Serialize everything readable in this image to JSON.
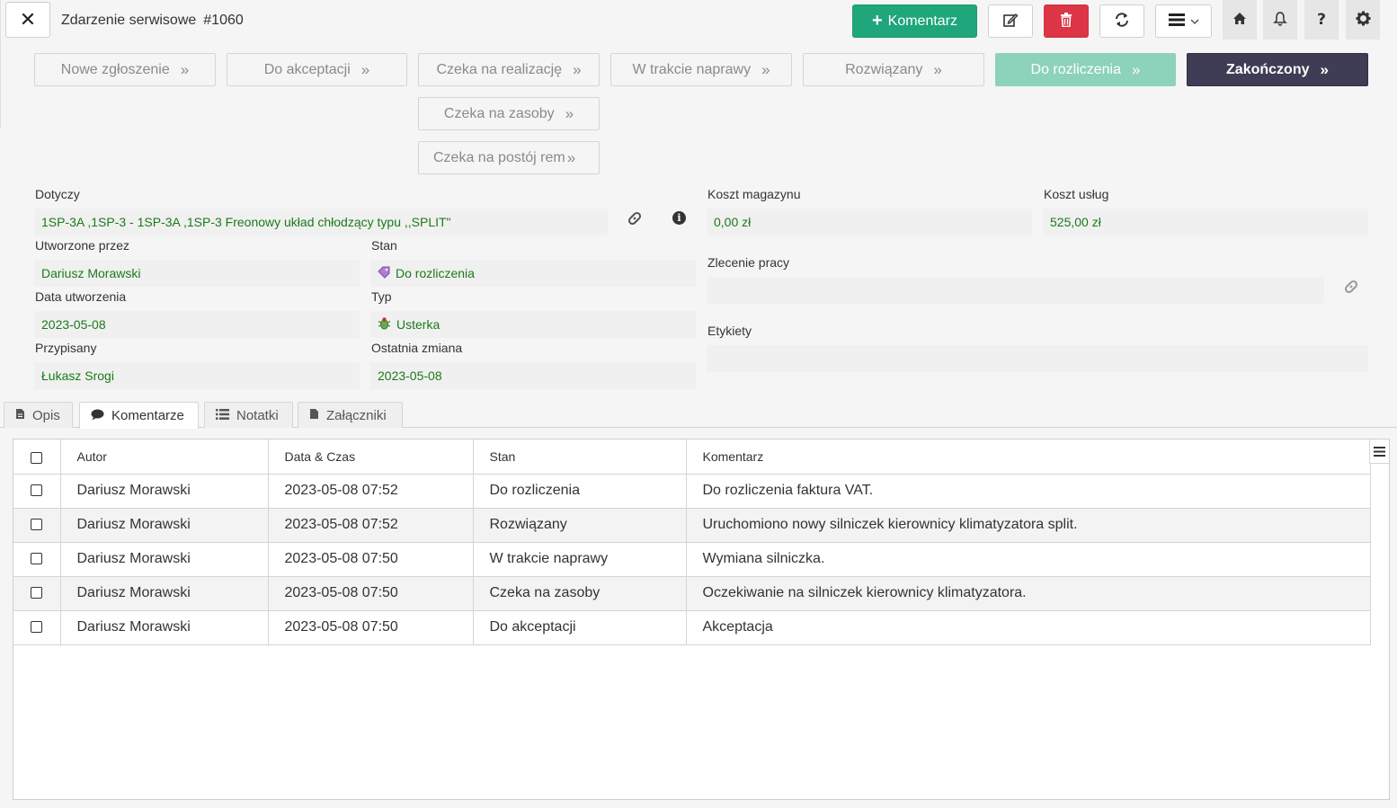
{
  "header": {
    "title": "Zdarzenie serwisowe",
    "record_number": "#1060",
    "close_icon": "✕",
    "comment_button_label": "Komentarz",
    "plus_icon": "+",
    "edit_icon": "✎",
    "delete_icon": "🗑",
    "refresh_icon": "⟳",
    "menu_icon": "☰",
    "menu_chevron": "⌄",
    "home_icon": "⌂",
    "bell_icon": "🔔",
    "help_icon": "?",
    "settings_icon": "⚙",
    "colors": {
      "comment": "#1fa67a",
      "delete": "#dc3545",
      "final_status": "#3f3d56",
      "current_status": "#8dd2bb"
    }
  },
  "workflow": {
    "chevron": "»",
    "statuses": [
      "Nowe zgłoszenie",
      "Do akceptacji",
      "Czeka na realizację",
      "W trakcie naprawy",
      "Rozwiązany",
      "Do rozliczenia",
      "Zakończony",
      "Czeka na zasoby",
      "Czeka na postój rem"
    ]
  },
  "form": {
    "dotyczy": {
      "label": "Dotyczy",
      "value": "1SP-3A ,1SP-3 - 1SP-3A ,1SP-3 Freonowy układ chłodzący typu ,,SPLIT\""
    },
    "link_icon": "🔗",
    "info_icon": "i",
    "koszt_magazynu": {
      "label": "Koszt magazynu",
      "value": "0,00 zł"
    },
    "koszt_uslug": {
      "label": "Koszt usług",
      "value": "525,00 zł"
    },
    "utworzone_przez": {
      "label": "Utworzone przez",
      "value": "Dariusz Morawski"
    },
    "stan": {
      "label": "Stan",
      "value": "Do rozliczenia",
      "icon": "🏷"
    },
    "zlecenie_pracy": {
      "label": "Zlecenie pracy",
      "value": ""
    },
    "data_utworzenia": {
      "label": "Data utworzenia",
      "value": "2023-05-08"
    },
    "typ": {
      "label": "Typ",
      "value": "Usterka",
      "icon": "🐞"
    },
    "etykiety": {
      "label": "Etykiety",
      "value": ""
    },
    "przypisany": {
      "label": "Przypisany",
      "value": "Łukasz Srogi"
    },
    "ostatnia_zmiana": {
      "label": "Ostatnia zmiana",
      "value": "2023-05-08"
    }
  },
  "tabs": [
    {
      "label": "Opis",
      "icon": "🗎"
    },
    {
      "label": "Komentarze",
      "icon": "💬"
    },
    {
      "label": "Notatki",
      "icon": "☰"
    },
    {
      "label": "Załączniki",
      "icon": "🗎"
    }
  ],
  "comments_table": {
    "columns": [
      "Autor",
      "Data & Czas",
      "Stan",
      "Komentarz"
    ],
    "column_menu_icon": "☰",
    "rows": [
      {
        "autor": "Dariusz Morawski",
        "data": "2023-05-08 07:52",
        "stan": "Do rozliczenia",
        "komentarz": "Do rozliczenia faktura VAT."
      },
      {
        "autor": "Dariusz Morawski",
        "data": "2023-05-08 07:52",
        "stan": "Rozwiązany",
        "komentarz": "Uruchomiono nowy silniczek kierownicy klimatyzatora split."
      },
      {
        "autor": "Dariusz Morawski",
        "data": "2023-05-08 07:50",
        "stan": "W trakcie naprawy",
        "komentarz": "Wymiana silniczka."
      },
      {
        "autor": "Dariusz Morawski",
        "data": "2023-05-08 07:50",
        "stan": "Czeka na zasoby",
        "komentarz": "Oczekiwanie na silniczek kierownicy klimatyzatora."
      },
      {
        "autor": "Dariusz Morawski",
        "data": "2023-05-08 07:50",
        "stan": "Do akceptacji",
        "komentarz": "Akceptacja"
      }
    ]
  }
}
